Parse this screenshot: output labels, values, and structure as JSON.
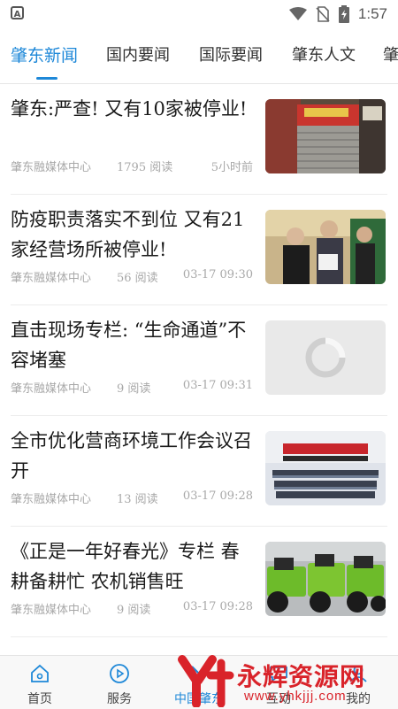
{
  "status_bar": {
    "time": "1:57",
    "app_icon_letter": "A"
  },
  "tabs": [
    {
      "label": "肇东新闻",
      "active": true
    },
    {
      "label": "国内要闻"
    },
    {
      "label": "国际要闻"
    },
    {
      "label": "肇东人文"
    },
    {
      "label": "肇"
    }
  ],
  "news": [
    {
      "title": "肇东:严查! 又有10家被停业!",
      "source": "肇东融媒体中心",
      "reads": "1795 阅读",
      "time": "5小时前",
      "thumb": "shop-front-photo"
    },
    {
      "title": "防疫职责落实不到位 又有21家经营场所被停业!",
      "source": "肇东融媒体中心",
      "reads": "56 阅读",
      "time": "03-17 09:30",
      "thumb": "inspection-photo"
    },
    {
      "title": "直击现场专栏: “生命通道”不容堵塞",
      "source": "肇东融媒体中心",
      "reads": "9 阅读",
      "time": "03-17 09:31",
      "thumb": "loading-placeholder"
    },
    {
      "title": "全市优化营商环境工作会议召开",
      "source": "肇东融媒体中心",
      "reads": "13 阅读",
      "time": "03-17 09:28",
      "thumb": "meeting-hall-photo"
    },
    {
      "title": "《正是一年好春光》专栏 春耕备耕忙 农机销售旺",
      "source": "肇东融媒体中心",
      "reads": "9 阅读",
      "time": "03-17 09:28",
      "thumb": "tractors-photo"
    }
  ],
  "bottom_nav": [
    {
      "label": "首页",
      "icon": "home-icon"
    },
    {
      "label": "服务",
      "icon": "play-circle-icon"
    },
    {
      "label": "中国肇东",
      "icon": "zhaodong-logo-icon",
      "active": true
    },
    {
      "label": "互动",
      "icon": "chat-icon"
    },
    {
      "label": "我的",
      "icon": "user-icon"
    }
  ],
  "watermark": {
    "text": "永辉资源网",
    "url": "www.yhkjjj.com"
  },
  "colors": {
    "accent": "#1e88d8",
    "watermark": "#d9232a"
  }
}
